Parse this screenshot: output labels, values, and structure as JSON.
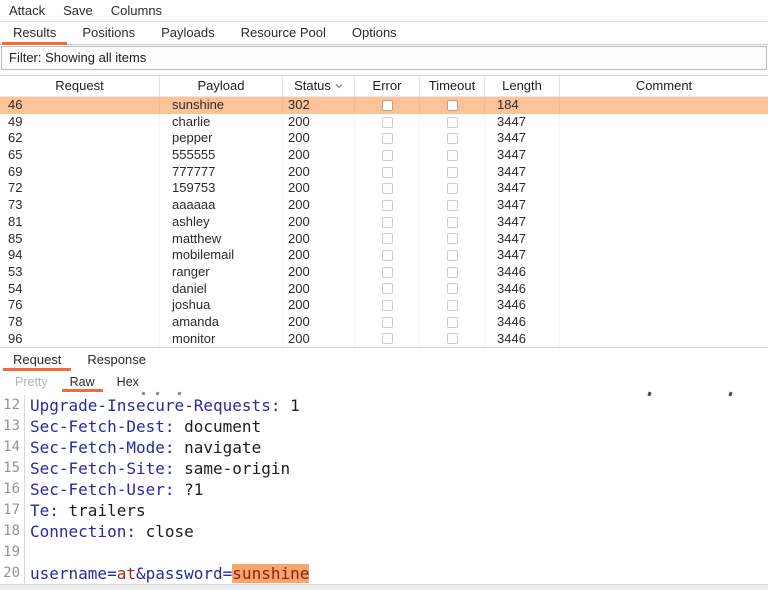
{
  "menu": {
    "items": [
      "Attack",
      "Save",
      "Columns"
    ]
  },
  "tabs": {
    "items": [
      "Results",
      "Positions",
      "Payloads",
      "Resource Pool",
      "Options"
    ],
    "active": "Results"
  },
  "filter": {
    "text": "Filter: Showing all items"
  },
  "results_table": {
    "columns": [
      "Request",
      "Payload",
      "Status",
      "Error",
      "Timeout",
      "Length",
      "Comment"
    ],
    "sort_column": "Status",
    "sort_icon": "chevron-down",
    "rows": [
      {
        "request": "46",
        "payload": "sunshine",
        "status": "302",
        "error": false,
        "timeout": false,
        "length": "184",
        "comment": "",
        "selected": true
      },
      {
        "request": "49",
        "payload": "charlie",
        "status": "200",
        "error": false,
        "timeout": false,
        "length": "3447",
        "comment": "",
        "selected": false
      },
      {
        "request": "62",
        "payload": "pepper",
        "status": "200",
        "error": false,
        "timeout": false,
        "length": "3447",
        "comment": "",
        "selected": false
      },
      {
        "request": "65",
        "payload": "555555",
        "status": "200",
        "error": false,
        "timeout": false,
        "length": "3447",
        "comment": "",
        "selected": false
      },
      {
        "request": "69",
        "payload": "777777",
        "status": "200",
        "error": false,
        "timeout": false,
        "length": "3447",
        "comment": "",
        "selected": false
      },
      {
        "request": "72",
        "payload": "159753",
        "status": "200",
        "error": false,
        "timeout": false,
        "length": "3447",
        "comment": "",
        "selected": false
      },
      {
        "request": "73",
        "payload": "aaaaaa",
        "status": "200",
        "error": false,
        "timeout": false,
        "length": "3447",
        "comment": "",
        "selected": false
      },
      {
        "request": "81",
        "payload": "ashley",
        "status": "200",
        "error": false,
        "timeout": false,
        "length": "3447",
        "comment": "",
        "selected": false
      },
      {
        "request": "85",
        "payload": "matthew",
        "status": "200",
        "error": false,
        "timeout": false,
        "length": "3447",
        "comment": "",
        "selected": false
      },
      {
        "request": "94",
        "payload": "mobilemail",
        "status": "200",
        "error": false,
        "timeout": false,
        "length": "3447",
        "comment": "",
        "selected": false
      },
      {
        "request": "53",
        "payload": "ranger",
        "status": "200",
        "error": false,
        "timeout": false,
        "length": "3446",
        "comment": "",
        "selected": false
      },
      {
        "request": "54",
        "payload": "daniel",
        "status": "200",
        "error": false,
        "timeout": false,
        "length": "3446",
        "comment": "",
        "selected": false
      },
      {
        "request": "76",
        "payload": "joshua",
        "status": "200",
        "error": false,
        "timeout": false,
        "length": "3446",
        "comment": "",
        "selected": false
      },
      {
        "request": "78",
        "payload": "amanda",
        "status": "200",
        "error": false,
        "timeout": false,
        "length": "3446",
        "comment": "",
        "selected": false
      },
      {
        "request": "96",
        "payload": "monitor",
        "status": "200",
        "error": false,
        "timeout": false,
        "length": "3446",
        "comment": "",
        "selected": false
      }
    ]
  },
  "message_tabs": {
    "items": [
      "Request",
      "Response"
    ],
    "active": "Request"
  },
  "view_tabs": {
    "items": [
      "Pretty",
      "Raw",
      "Hex"
    ],
    "active": "Raw",
    "disabled": [
      "Pretty"
    ]
  },
  "editor": {
    "lines": [
      {
        "num": "12",
        "segments": [
          {
            "t": "Upgrade-Insecure-Requests:",
            "c": "name"
          },
          {
            "t": " 1",
            "c": "plain"
          }
        ]
      },
      {
        "num": "13",
        "segments": [
          {
            "t": "Sec-Fetch-Dest:",
            "c": "name"
          },
          {
            "t": " document",
            "c": "plain"
          }
        ]
      },
      {
        "num": "14",
        "segments": [
          {
            "t": "Sec-Fetch-Mode:",
            "c": "name"
          },
          {
            "t": " navigate",
            "c": "plain"
          }
        ]
      },
      {
        "num": "15",
        "segments": [
          {
            "t": "Sec-Fetch-Site:",
            "c": "name"
          },
          {
            "t": " same-origin",
            "c": "plain"
          }
        ]
      },
      {
        "num": "16",
        "segments": [
          {
            "t": "Sec-Fetch-User:",
            "c": "name"
          },
          {
            "t": " ?1",
            "c": "plain"
          }
        ]
      },
      {
        "num": "17",
        "segments": [
          {
            "t": "Te:",
            "c": "name"
          },
          {
            "t": " trailers",
            "c": "plain"
          }
        ]
      },
      {
        "num": "18",
        "segments": [
          {
            "t": "Connection:",
            "c": "name"
          },
          {
            "t": " close",
            "c": "plain"
          }
        ]
      },
      {
        "num": "19",
        "segments": []
      },
      {
        "num": "20",
        "segments": [
          {
            "t": "username=",
            "c": "name"
          },
          {
            "t": "at",
            "c": "value"
          },
          {
            "t": "&password=",
            "c": "name"
          },
          {
            "t": "sunshine",
            "c": "value",
            "hl": true
          }
        ]
      }
    ]
  },
  "colors": {
    "accent": "#f26b3a",
    "selected_row": "#fdc397",
    "payload_highlight": "#f7a76b",
    "header_name": "#2929a3",
    "param_value": "#a32b1d"
  }
}
